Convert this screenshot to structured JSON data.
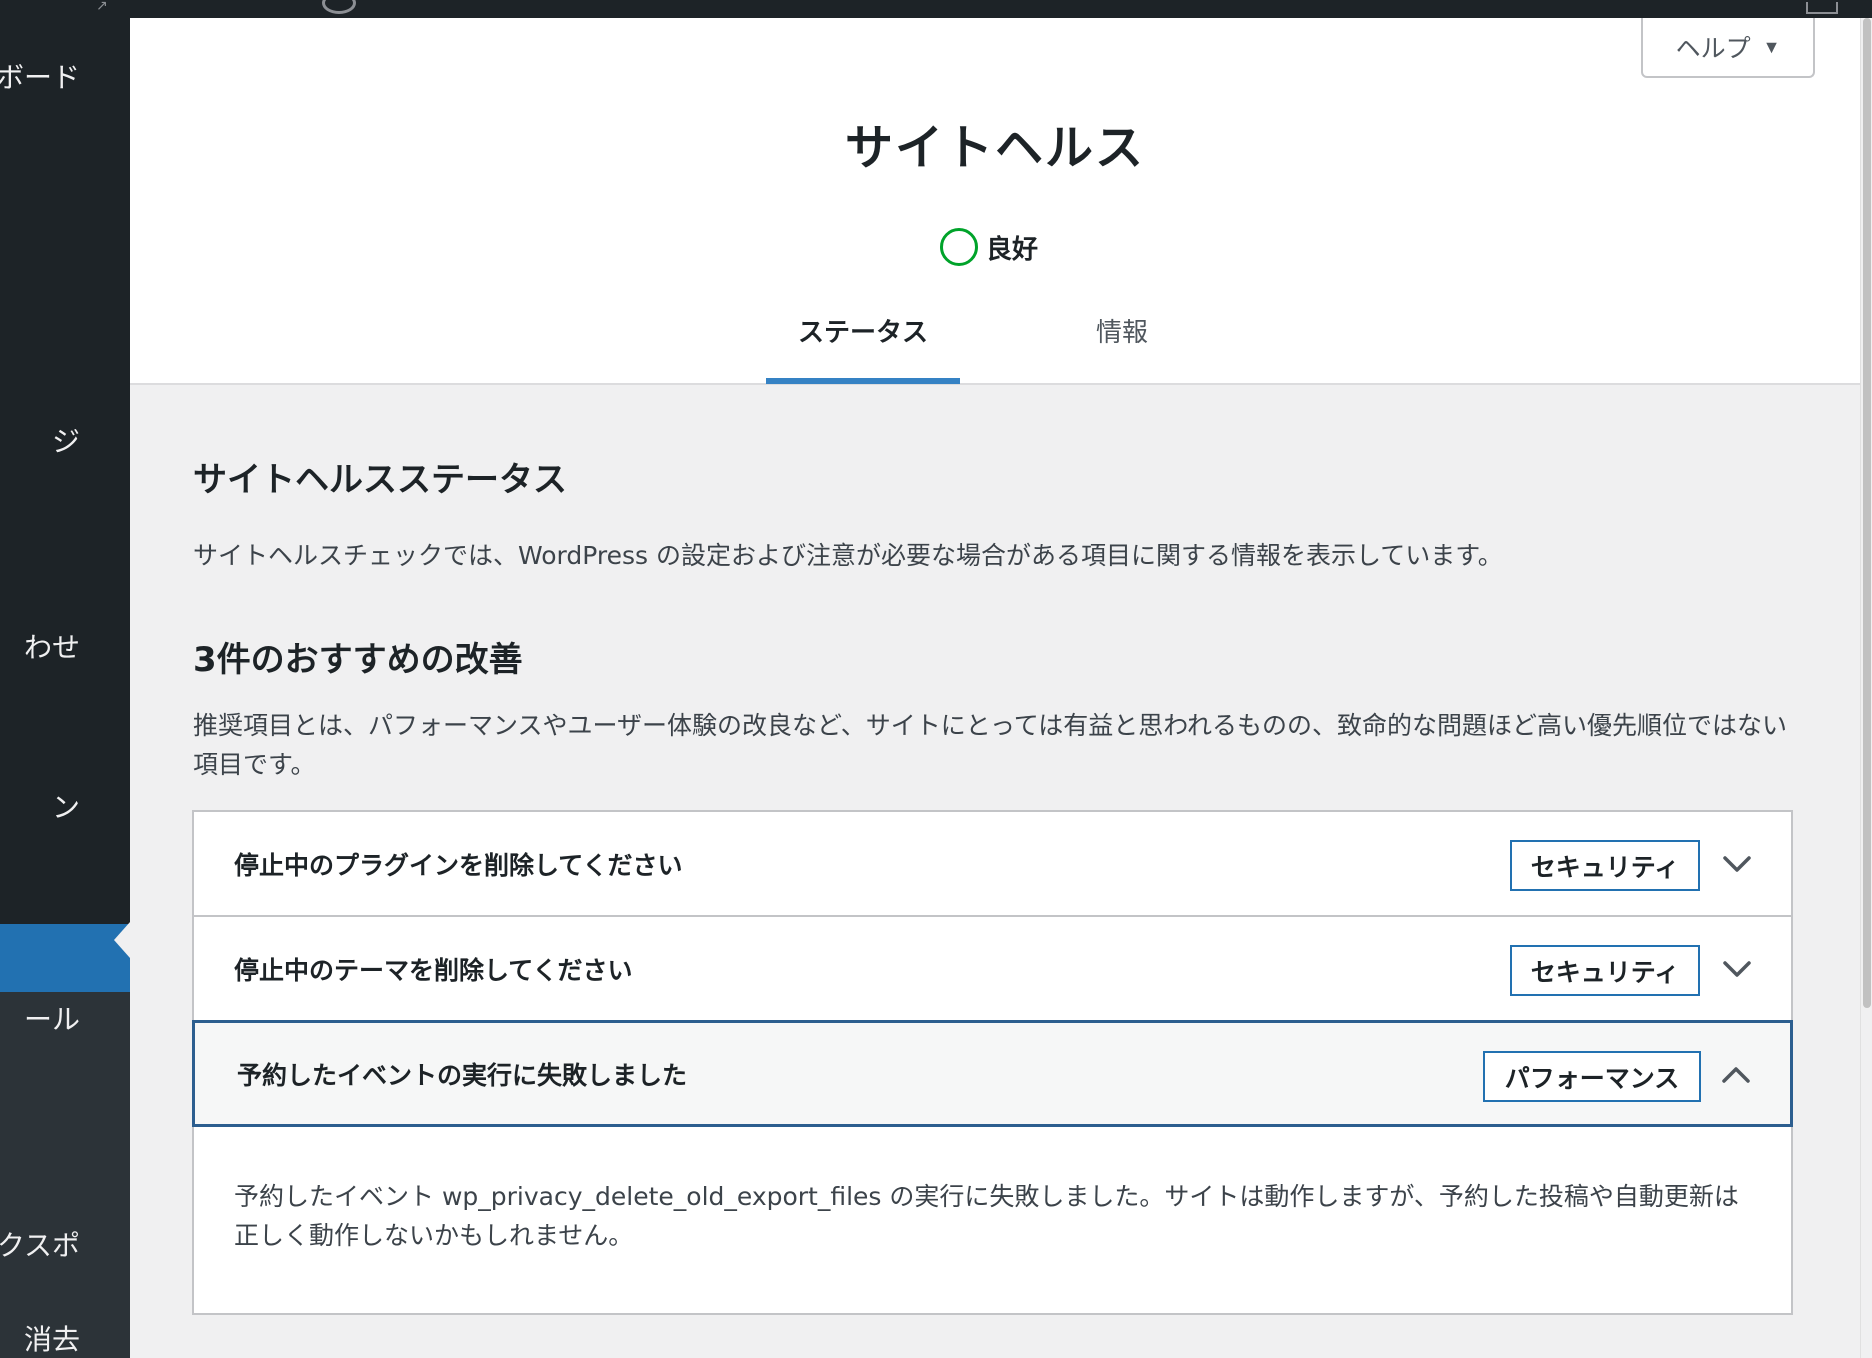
{
  "sidebar": {
    "items": [
      {
        "label": "ボード"
      },
      {
        "label": "ジ"
      },
      {
        "label": "わせ"
      },
      {
        "label": "ン"
      },
      {
        "label": "ール"
      },
      {
        "label": "エクスポ"
      },
      {
        "label": "消去"
      }
    ]
  },
  "header": {
    "help_label": "ヘルプ",
    "help_caret": "▼",
    "title": "サイトヘルス",
    "status_label": "良好",
    "tabs": [
      {
        "label": "ステータス",
        "active": true
      },
      {
        "label": "情報",
        "active": false
      }
    ]
  },
  "main": {
    "section_title": "サイトヘルスステータス",
    "section_desc": "サイトヘルスチェックでは、WordPress の設定および注意が必要な場合がある項目に関する情報を表示しています。",
    "improve_title": "3件のおすすめの改善",
    "improve_desc": "推奨項目とは、パフォーマンスやユーザー体験の改良など、サイトにとっては有益と思われるものの、致命的な問題ほど高い優先順位ではない項目です。",
    "items": [
      {
        "label": "停止中のプラグインを削除してください",
        "badge": "セキュリティ",
        "expanded": false
      },
      {
        "label": "停止中のテーマを削除してください",
        "badge": "セキュリティ",
        "expanded": false
      },
      {
        "label": "予約したイベントの実行に失敗しました",
        "badge": "パフォーマンス",
        "expanded": true,
        "content": "予約したイベント wp_privacy_delete_old_export_files の実行に失敗しました。サイトは動作しますが、予約した投稿や自動更新は正しく動作しないかもしれません。"
      }
    ]
  },
  "colors": {
    "admin_bg": "#1d2327",
    "accent": "#2271b1",
    "good": "#00a32a",
    "page_bg": "#f0f0f1"
  }
}
